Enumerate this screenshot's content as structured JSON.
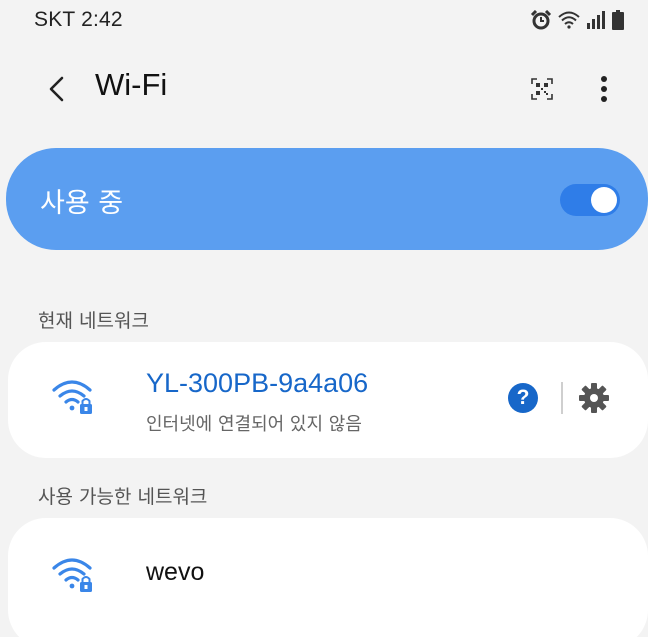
{
  "status_bar": {
    "carrier_time": "SKT 2:42",
    "icons": [
      "alarm-icon",
      "wifi-signal-icon",
      "cell-signal-icon",
      "battery-icon"
    ]
  },
  "app_bar": {
    "title": "Wi-Fi",
    "back_icon": "back-arrow-icon",
    "qr_icon": "qr-code-icon",
    "more_icon": "more-options-icon"
  },
  "wifi_toggle": {
    "label": "사용 중",
    "state": "on",
    "accent_color": "#5b9ef0"
  },
  "current_network": {
    "header": "현재 네트워크",
    "ssid": "YL-300PB-9a4a06",
    "status": "인터넷에 연결되어 있지 않음",
    "help_label": "?",
    "ssid_color": "#1767c9"
  },
  "available_networks": {
    "header": "사용 가능한 네트워크",
    "items": [
      {
        "ssid": "wevo",
        "secured": true
      }
    ]
  }
}
